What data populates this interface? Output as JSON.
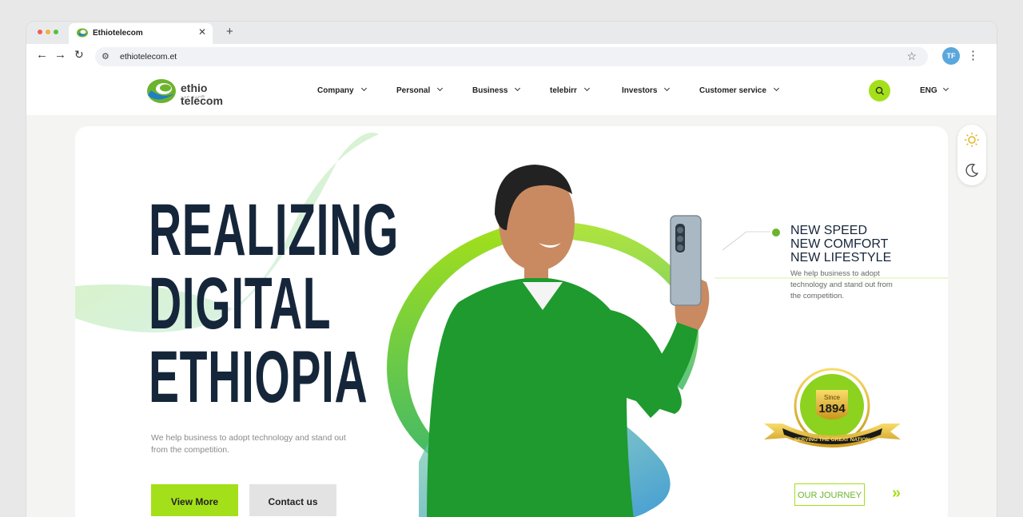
{
  "browser": {
    "tab_title": "Ethiotelecom",
    "url": "ethiotelecom.et",
    "avatar_initials": "TF",
    "traffic_lights": [
      "#ee5f56",
      "#f0b13e",
      "#58c140"
    ]
  },
  "header": {
    "logo_text": "ethio telecom",
    "logo_subtext": "ኢትዮ ቴሌኮም",
    "nav": [
      {
        "label": "Company"
      },
      {
        "label": "Personal"
      },
      {
        "label": "Business"
      },
      {
        "label": "telebirr"
      },
      {
        "label": "Investors"
      },
      {
        "label": "Customer service"
      }
    ],
    "search_icon": "search-icon",
    "language": "ENG"
  },
  "hero": {
    "headline": [
      "REALIZING",
      "DIGITAL",
      "ETHIOPIA"
    ],
    "description": "We help business to adopt technology and stand out from the competition.",
    "buttons": {
      "view_more": "View More",
      "contact_us": "Contact us"
    },
    "tagline": [
      "NEW SPEED",
      "NEW COMFORT",
      "NEW LIFESTYLE"
    ],
    "side_description": "We help business to adopt technology and stand out from the competition.",
    "badge": {
      "since": "Since",
      "year": "1894",
      "ribbon": "SERVING THE GREAT NATION"
    },
    "journey_label": "OUR JOURNEY"
  },
  "theme_toggle": {
    "light_icon": "sun-icon",
    "dark_icon": "moon-icon"
  },
  "colors": {
    "accent": "#a4e01a",
    "brand_green": "#6cb32e",
    "brand_blue": "#1f7fc6",
    "headline": "#16263a"
  }
}
